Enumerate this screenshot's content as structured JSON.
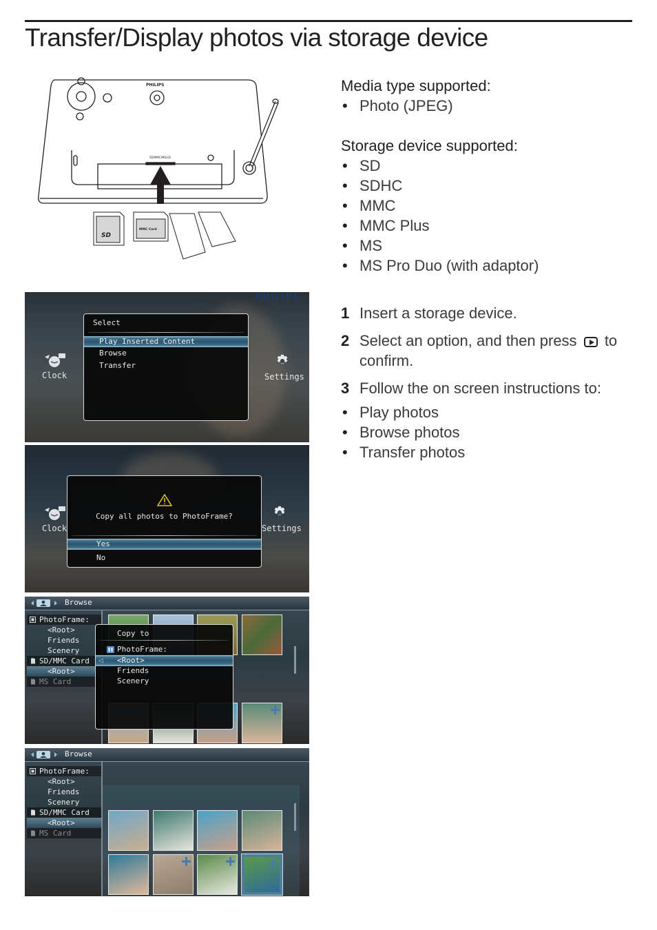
{
  "page": {
    "title": "Transfer/Display photos via storage device"
  },
  "illustration": {
    "brand": "PHILIPS",
    "card_labels": [
      "SD",
      "MMC Card"
    ],
    "slot_label": "SD/MMC/MS/xD"
  },
  "media_section": {
    "heading": "Media type supported:",
    "items": [
      "Photo (JPEG)"
    ]
  },
  "storage_section": {
    "heading": "Storage device supported:",
    "items": [
      "SD",
      "SDHC",
      "MMC",
      "MMC Plus",
      "MS",
      "MS Pro Duo (with adaptor)"
    ]
  },
  "steps": [
    {
      "num": "1",
      "text": "Insert a storage device."
    },
    {
      "num": "2",
      "text_before": "Select an option, and then press",
      "key_icon": "play-button-icon",
      "text_after": "to",
      "text_line2": "confirm."
    },
    {
      "num": "3",
      "text": "Follow the on screen instructions to:"
    }
  ],
  "step3_bullets": [
    "Play photos",
    "Browse photos",
    "Transfer photos"
  ],
  "screen1": {
    "brand": "PHILIPS",
    "left_icon": {
      "icon": "clock-icon",
      "label": "Clock"
    },
    "right_icon": {
      "icon": "settings-gear-icon",
      "label": "Settings"
    },
    "dialog_title": "Select",
    "options": [
      "Play Inserted Content",
      "Browse",
      "Transfer"
    ],
    "selected_index": 0
  },
  "screen2": {
    "left_icon": {
      "icon": "clock-icon",
      "label": "Clock"
    },
    "right_icon": {
      "icon": "settings-gear-icon",
      "label": "Settings"
    },
    "warning_icon": "warning-triangle-icon",
    "prompt": "Copy all photos to PhotoFrame?",
    "options": [
      "Yes",
      "No"
    ],
    "selected_index": 0
  },
  "screen3": {
    "header": "Browse",
    "tree": [
      {
        "label": "PhotoFrame:",
        "type": "device",
        "icon": "frame-icon"
      },
      {
        "label": "<Root>",
        "type": "folder"
      },
      {
        "label": "Friends",
        "type": "folder"
      },
      {
        "label": "Scenery",
        "type": "folder"
      },
      {
        "label": "SD/MMC Card",
        "type": "device",
        "icon": "sd-card-icon"
      },
      {
        "label": "<Root>",
        "type": "folder",
        "selected": true
      },
      {
        "label": "MS Card",
        "type": "device",
        "icon": "ms-card-icon",
        "disabled": true
      }
    ],
    "copy_dialog": {
      "title": "Copy to",
      "device": "PhotoFrame:",
      "options": [
        "<Root>",
        "Friends",
        "Scenery"
      ],
      "selected_index": 0
    }
  },
  "screen4": {
    "header": "Browse",
    "tree": [
      {
        "label": "PhotoFrame:",
        "type": "device",
        "icon": "frame-icon"
      },
      {
        "label": "<Root>",
        "type": "folder"
      },
      {
        "label": "Friends",
        "type": "folder"
      },
      {
        "label": "Scenery",
        "type": "folder"
      },
      {
        "label": "SD/MMC Card",
        "type": "device",
        "icon": "sd-card-icon"
      },
      {
        "label": "<Root>",
        "type": "folder",
        "selected": true
      },
      {
        "label": "MS Card",
        "type": "device",
        "icon": "ms-card-icon",
        "disabled": true
      }
    ],
    "thumbnails": [
      {
        "subject": "boy with fish",
        "colors": [
          "#6fa6c9",
          "#c9b08e"
        ],
        "marked": false
      },
      {
        "subject": "woman smiling",
        "colors": [
          "#3e7a6e",
          "#e8e4de"
        ],
        "marked": false
      },
      {
        "subject": "couple on beach",
        "colors": [
          "#4aa3c8",
          "#c9a08a"
        ],
        "marked": false
      },
      {
        "subject": "mother and baby pool",
        "colors": [
          "#5a8a78",
          "#d8b49a"
        ],
        "marked": false
      },
      {
        "subject": "boy in hat",
        "colors": [
          "#2f7a9a",
          "#e0b89a"
        ],
        "marked": false
      },
      {
        "subject": "sand tracks",
        "colors": [
          "#b8a898",
          "#8c7c6c"
        ],
        "marked": true
      },
      {
        "subject": "white flower",
        "colors": [
          "#5a8a4a",
          "#e8e8e0"
        ],
        "marked": true
      },
      {
        "subject": "green leaves",
        "colors": [
          "#5a9a4a",
          "#2e6a9a"
        ],
        "marked": true,
        "focused": true
      }
    ]
  }
}
